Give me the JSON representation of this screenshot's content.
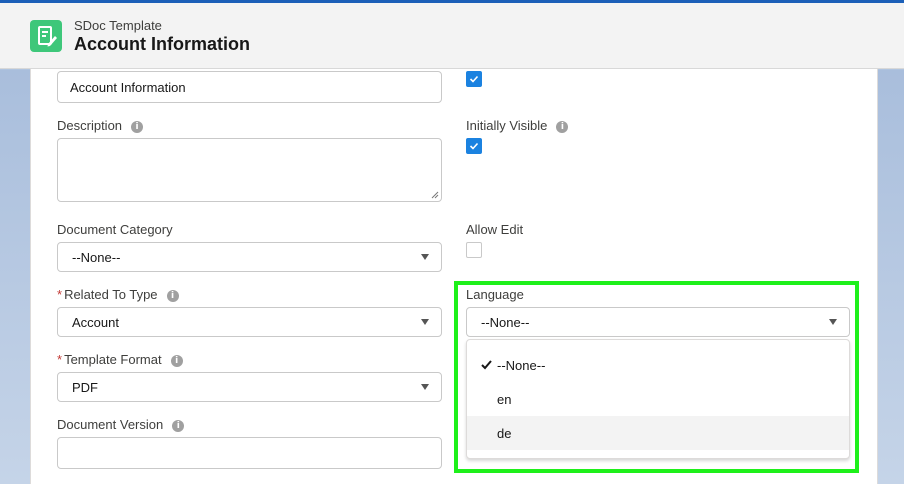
{
  "header": {
    "object_label": "SDoc Template",
    "record_title": "Account Information"
  },
  "form": {
    "name_value": "Account Information",
    "top_checkbox_checked": true,
    "description": {
      "label": "Description",
      "value": ""
    },
    "initially_visible": {
      "label": "Initially Visible",
      "checked": true
    },
    "document_category": {
      "label": "Document Category",
      "value": "--None--"
    },
    "allow_edit": {
      "label": "Allow Edit",
      "checked": false
    },
    "related_to_type": {
      "required_mark": "*",
      "label": "Related To Type",
      "value": "Account"
    },
    "language": {
      "label": "Language",
      "value": "--None--"
    },
    "template_format": {
      "required_mark": "*",
      "label": "Template Format",
      "value": "PDF"
    },
    "document_version": {
      "label": "Document Version",
      "value": ""
    },
    "info_glyph": "i"
  },
  "language_dropdown": {
    "options": [
      {
        "label": "--None--",
        "selected": true
      },
      {
        "label": "en",
        "selected": false
      },
      {
        "label": "de",
        "selected": false,
        "hovered": true
      }
    ]
  },
  "colors": {
    "highlight": "#1ef01a",
    "checkbox_blue": "#1b82e0",
    "app_icon_green": "#3ec77a",
    "required_red": "#c23934"
  },
  "icons": {
    "app": "document-edit-icon",
    "info": "info-icon",
    "select": "chevron-down-icon",
    "selected_option": "checkmark-icon"
  }
}
